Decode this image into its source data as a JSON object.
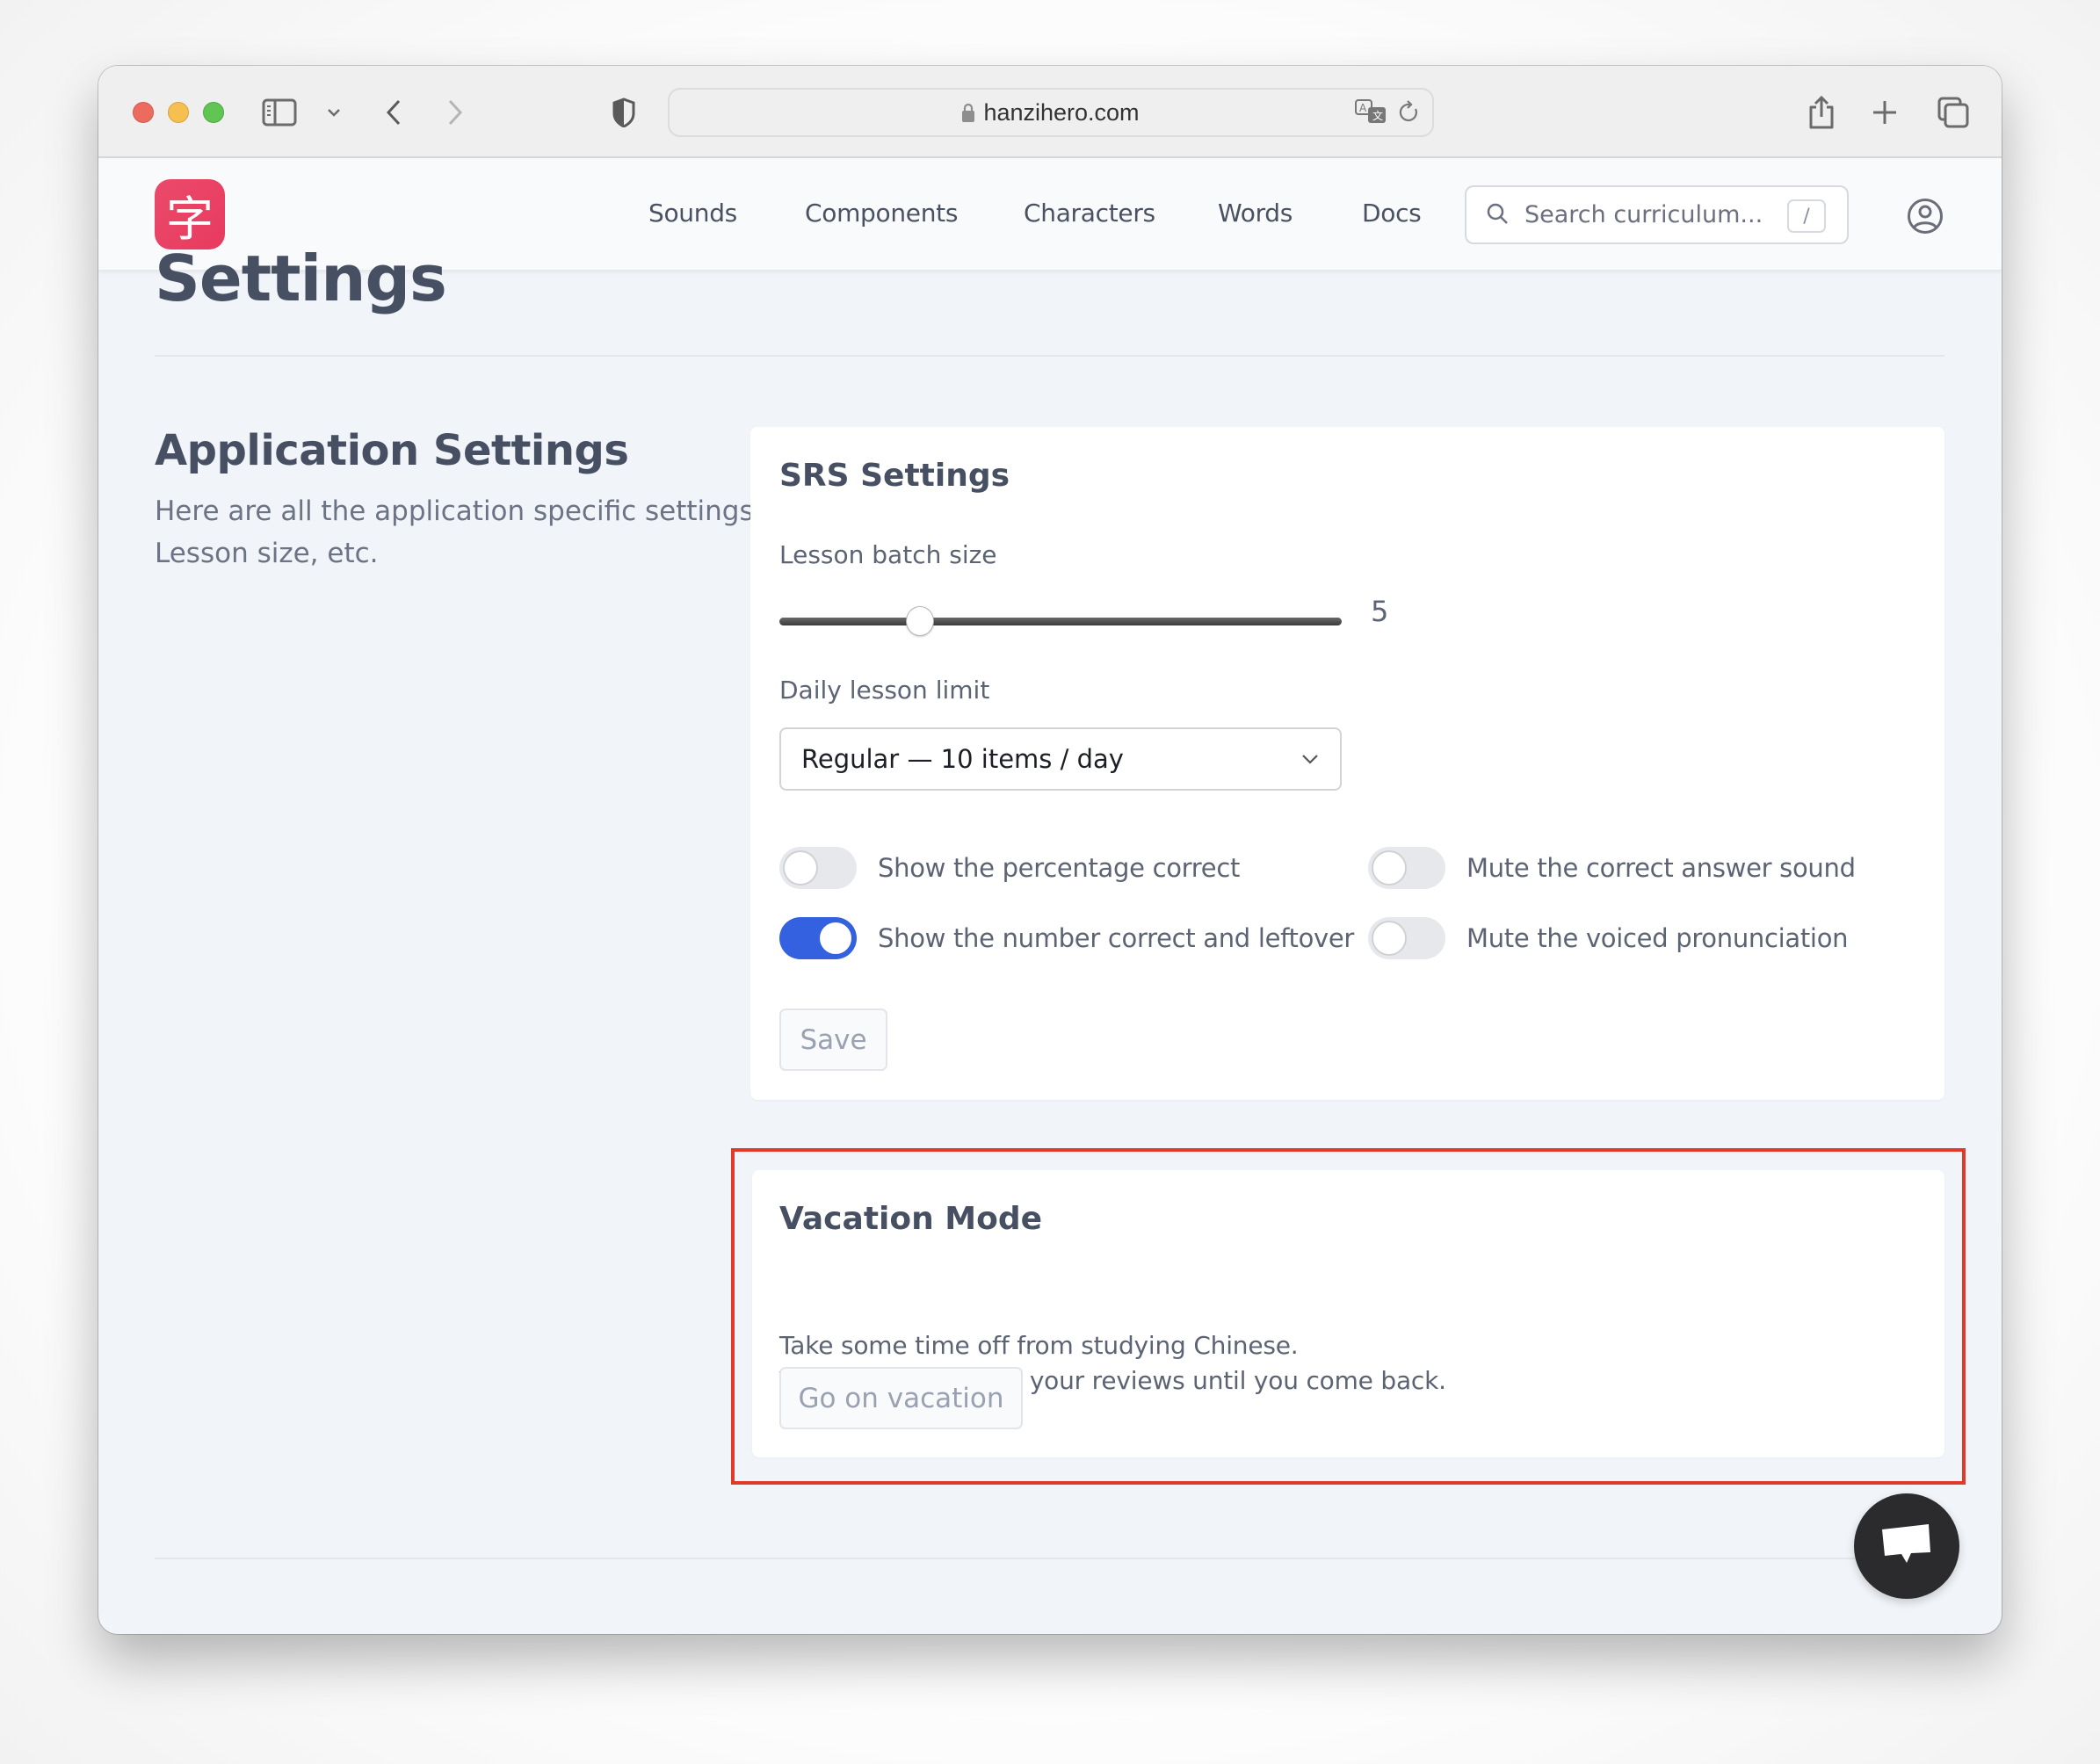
{
  "browser": {
    "url": "hanzihero.com",
    "toolbar_icons": [
      "sidebar-icon",
      "chevron-down-icon",
      "back-icon",
      "forward-icon",
      "shield-icon",
      "share-icon",
      "new-tab-icon",
      "tabs-overview-icon"
    ],
    "url_icons": [
      "lock-icon",
      "translate-icon",
      "reload-icon"
    ]
  },
  "nav": {
    "logo_glyph": "字",
    "items": [
      {
        "label": "Sounds"
      },
      {
        "label": "Components"
      },
      {
        "label": "Characters"
      },
      {
        "label": "Words"
      },
      {
        "label": "Docs"
      }
    ],
    "search": {
      "placeholder": "Search curriculum...",
      "shortcut": "/"
    },
    "profile_icon": "user-circle-icon"
  },
  "page": {
    "title": "Settings",
    "section": {
      "title": "Application Settings",
      "description_line1": "Here are all the application specific settings.",
      "description_line2": "Lesson size, etc."
    }
  },
  "srs": {
    "title": "SRS Settings",
    "batch_size": {
      "label": "Lesson batch size",
      "value": "5",
      "slider_fraction": 0.25
    },
    "daily_limit": {
      "label": "Daily lesson limit",
      "selected": "Regular — 10 items / day"
    },
    "toggles": [
      {
        "label": "Show the percentage correct",
        "on": false
      },
      {
        "label": "Mute the correct answer sound",
        "on": false
      },
      {
        "label": "Show the number correct and leftover",
        "on": true
      },
      {
        "label": "Mute the voiced pronunciation",
        "on": false
      }
    ],
    "save_label": "Save"
  },
  "vacation": {
    "title": "Vacation Mode",
    "description_line1": "Take some time off from studying Chinese.",
    "description_line2": "This will suspend all your reviews until you come back.",
    "button_label": "Go on vacation"
  },
  "colors": {
    "brand": "#e83f62",
    "toggle_on": "#3461df",
    "highlight": "#e03b2a",
    "chat_button": "#2b2b2d"
  },
  "chat": {
    "icon": "chat-bubble-icon"
  }
}
